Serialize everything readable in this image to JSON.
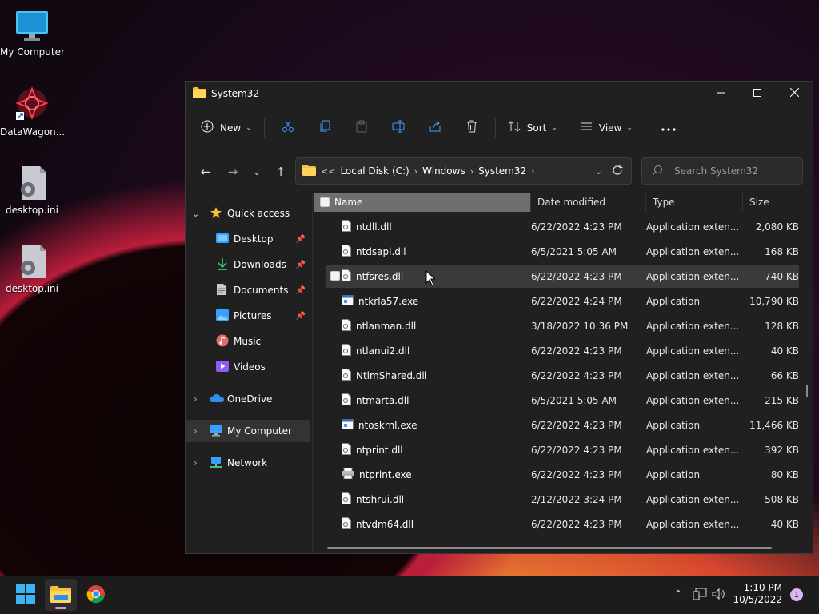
{
  "desktop": {
    "icons": [
      {
        "label": "My Computer",
        "icon": "monitor-icon"
      },
      {
        "label": "DataWagon...",
        "icon": "shortcut-icon"
      },
      {
        "label": "desktop.ini",
        "icon": "settings-file-icon"
      },
      {
        "label": "desktop.ini",
        "icon": "settings-file-icon"
      }
    ]
  },
  "window": {
    "title": "System32",
    "toolbar": {
      "new_label": "New",
      "sort_label": "Sort",
      "view_label": "View"
    },
    "address": {
      "overflow": "<<",
      "crumbs": [
        "Local Disk (C:)",
        "Windows",
        "System32"
      ]
    },
    "search": {
      "placeholder": "Search System32"
    },
    "nav": {
      "quick_access": "Quick access",
      "items": [
        {
          "label": "Desktop",
          "pinned": true
        },
        {
          "label": "Downloads",
          "pinned": true
        },
        {
          "label": "Documents",
          "pinned": true
        },
        {
          "label": "Pictures",
          "pinned": true
        },
        {
          "label": "Music",
          "pinned": false
        },
        {
          "label": "Videos",
          "pinned": false
        }
      ],
      "onedrive": "OneDrive",
      "my_computer": "My Computer",
      "network": "Network"
    },
    "columns": {
      "name": "Name",
      "date": "Date modified",
      "type": "Type",
      "size": "Size"
    },
    "files": [
      {
        "name": "ntdll.dll",
        "date": "6/22/2022 4:23 PM",
        "type": "Application exten...",
        "size": "2,080 KB",
        "kind": "dll"
      },
      {
        "name": "ntdsapi.dll",
        "date": "6/5/2021 5:05 AM",
        "type": "Application exten...",
        "size": "168 KB",
        "kind": "dll"
      },
      {
        "name": "ntfsres.dll",
        "date": "6/22/2022 4:23 PM",
        "type": "Application exten...",
        "size": "740 KB",
        "kind": "dll"
      },
      {
        "name": "ntkrla57.exe",
        "date": "6/22/2022 4:24 PM",
        "type": "Application",
        "size": "10,790 KB",
        "kind": "exe"
      },
      {
        "name": "ntlanman.dll",
        "date": "3/18/2022 10:36 PM",
        "type": "Application exten...",
        "size": "128 KB",
        "kind": "dll"
      },
      {
        "name": "ntlanui2.dll",
        "date": "6/22/2022 4:23 PM",
        "type": "Application exten...",
        "size": "40 KB",
        "kind": "dll"
      },
      {
        "name": "NtlmShared.dll",
        "date": "6/22/2022 4:23 PM",
        "type": "Application exten...",
        "size": "66 KB",
        "kind": "dll"
      },
      {
        "name": "ntmarta.dll",
        "date": "6/5/2021 5:05 AM",
        "type": "Application exten...",
        "size": "215 KB",
        "kind": "dll"
      },
      {
        "name": "ntoskrnl.exe",
        "date": "6/22/2022 4:23 PM",
        "type": "Application",
        "size": "11,466 KB",
        "kind": "exe"
      },
      {
        "name": "ntprint.dll",
        "date": "6/22/2022 4:23 PM",
        "type": "Application exten...",
        "size": "392 KB",
        "kind": "dll"
      },
      {
        "name": "ntprint.exe",
        "date": "6/22/2022 4:23 PM",
        "type": "Application",
        "size": "80 KB",
        "kind": "printer"
      },
      {
        "name": "ntshrui.dll",
        "date": "2/12/2022 3:24 PM",
        "type": "Application exten...",
        "size": "508 KB",
        "kind": "dll"
      },
      {
        "name": "ntvdm64.dll",
        "date": "6/22/2022 4:23 PM",
        "type": "Application exten...",
        "size": "40 KB",
        "kind": "dll"
      }
    ]
  },
  "taskbar": {
    "time": "1:10 PM",
    "date": "10/5/2022",
    "notifications": "1"
  }
}
